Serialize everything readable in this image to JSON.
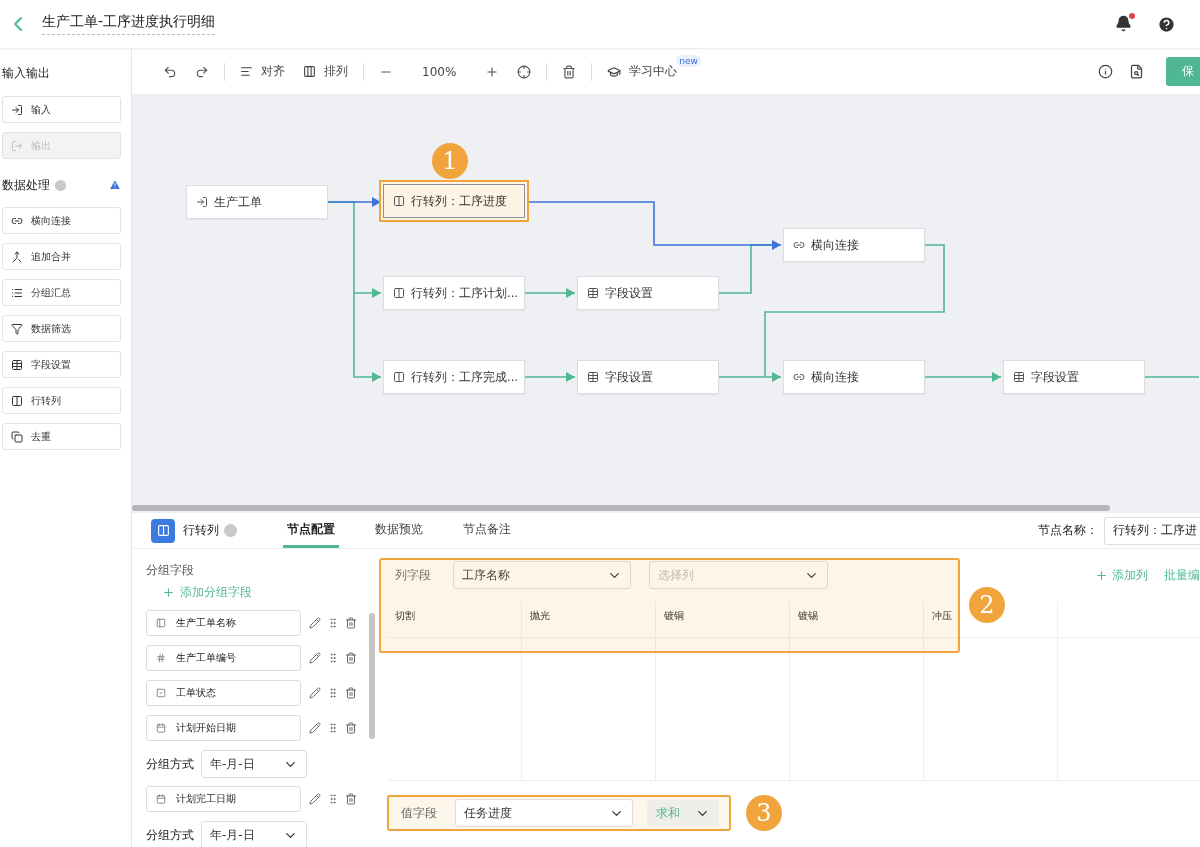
{
  "header": {
    "title": "生产工单-工序进度执行明细",
    "has_unread": true
  },
  "sidebar": {
    "sections": [
      {
        "title": "输入输出",
        "help": false,
        "warning": false,
        "items": [
          {
            "kind": "input",
            "label": "输入",
            "disabled": false
          },
          {
            "kind": "output",
            "label": "输出",
            "disabled": true
          }
        ]
      },
      {
        "title": "数据处理",
        "help": true,
        "warning": true,
        "items": [
          {
            "kind": "join",
            "label": "横向连接",
            "disabled": false
          },
          {
            "kind": "append",
            "label": "追加合并",
            "disabled": false
          },
          {
            "kind": "group",
            "label": "分组汇总",
            "disabled": false
          },
          {
            "kind": "filter",
            "label": "数据筛选",
            "disabled": false
          },
          {
            "kind": "fields",
            "label": "字段设置",
            "disabled": false
          },
          {
            "kind": "pivot",
            "label": "行转列",
            "disabled": false
          },
          {
            "kind": "dedupe",
            "label": "去重",
            "disabled": false
          }
        ]
      }
    ]
  },
  "toolbar": {
    "items": [
      {
        "kind": "undo"
      },
      {
        "kind": "redo"
      },
      {
        "kind": "divider"
      },
      {
        "kind": "align",
        "label": "对齐"
      },
      {
        "kind": "arrange",
        "label": "排列"
      },
      {
        "kind": "divider"
      },
      {
        "kind": "zoom_out"
      },
      {
        "kind": "zoom",
        "label": "100%"
      },
      {
        "kind": "zoom_in"
      },
      {
        "kind": "locate"
      },
      {
        "kind": "divider"
      },
      {
        "kind": "delete"
      },
      {
        "kind": "divider"
      },
      {
        "kind": "learn",
        "label": "学习中心",
        "badge": "new"
      }
    ],
    "right": [
      {
        "kind": "info"
      },
      {
        "kind": "preview"
      }
    ],
    "save_label": "保"
  },
  "canvas": {
    "nodes": [
      {
        "kind": "input",
        "label": "生产工单",
        "selected": false
      },
      {
        "kind": "pivot",
        "label": "行转列：工序进度",
        "selected": true,
        "marker": "1"
      },
      {
        "kind": "join",
        "label": "横向连接",
        "selected": false
      },
      {
        "kind": "pivot",
        "label": "行转列：工序计划...",
        "selected": false
      },
      {
        "kind": "fields",
        "label": "字段设置",
        "selected": false
      },
      {
        "kind": "pivot",
        "label": "行转列：工序完成...",
        "selected": false
      },
      {
        "kind": "fields",
        "label": "字段设置",
        "selected": false
      },
      {
        "kind": "join",
        "label": "横向连接",
        "selected": false
      },
      {
        "kind": "fields",
        "label": "字段设置",
        "selected": false
      }
    ]
  },
  "panel": {
    "node_type": "行转列",
    "tabs": [
      {
        "label": "节点配置",
        "selected": true
      },
      {
        "label": "数据预览",
        "selected": false
      },
      {
        "label": "节点备注",
        "selected": false
      }
    ],
    "node_name": {
      "label": "节点名称：",
      "value": "行转列：工序进"
    },
    "group_fields": {
      "title": "分组字段",
      "add_label": "添加分组字段",
      "items": [
        {
          "kind": "text",
          "name": "生产工单名称"
        },
        {
          "kind": "number",
          "name": "生产工单编号"
        },
        {
          "kind": "status",
          "name": "工单状态"
        },
        {
          "kind": "date",
          "name": "计划开始日期",
          "group_label": "分组方式",
          "group_value": "年-月-日"
        },
        {
          "kind": "date",
          "name": "计划完工日期",
          "group_label": "分组方式",
          "group_value": "年-月-日"
        }
      ]
    },
    "column_field": {
      "label": "列字段",
      "value": "工序名称",
      "placeholder": "选择列",
      "marker": "2",
      "add_label": "添加列",
      "batch_label": "批量编"
    },
    "table": {
      "columns": [
        "切割",
        "抛光",
        "镀铜",
        "镀锡",
        "冲压"
      ]
    },
    "value_field": {
      "label": "值字段",
      "value": "任务进度",
      "aggregate": "求和",
      "marker": "3"
    }
  }
}
